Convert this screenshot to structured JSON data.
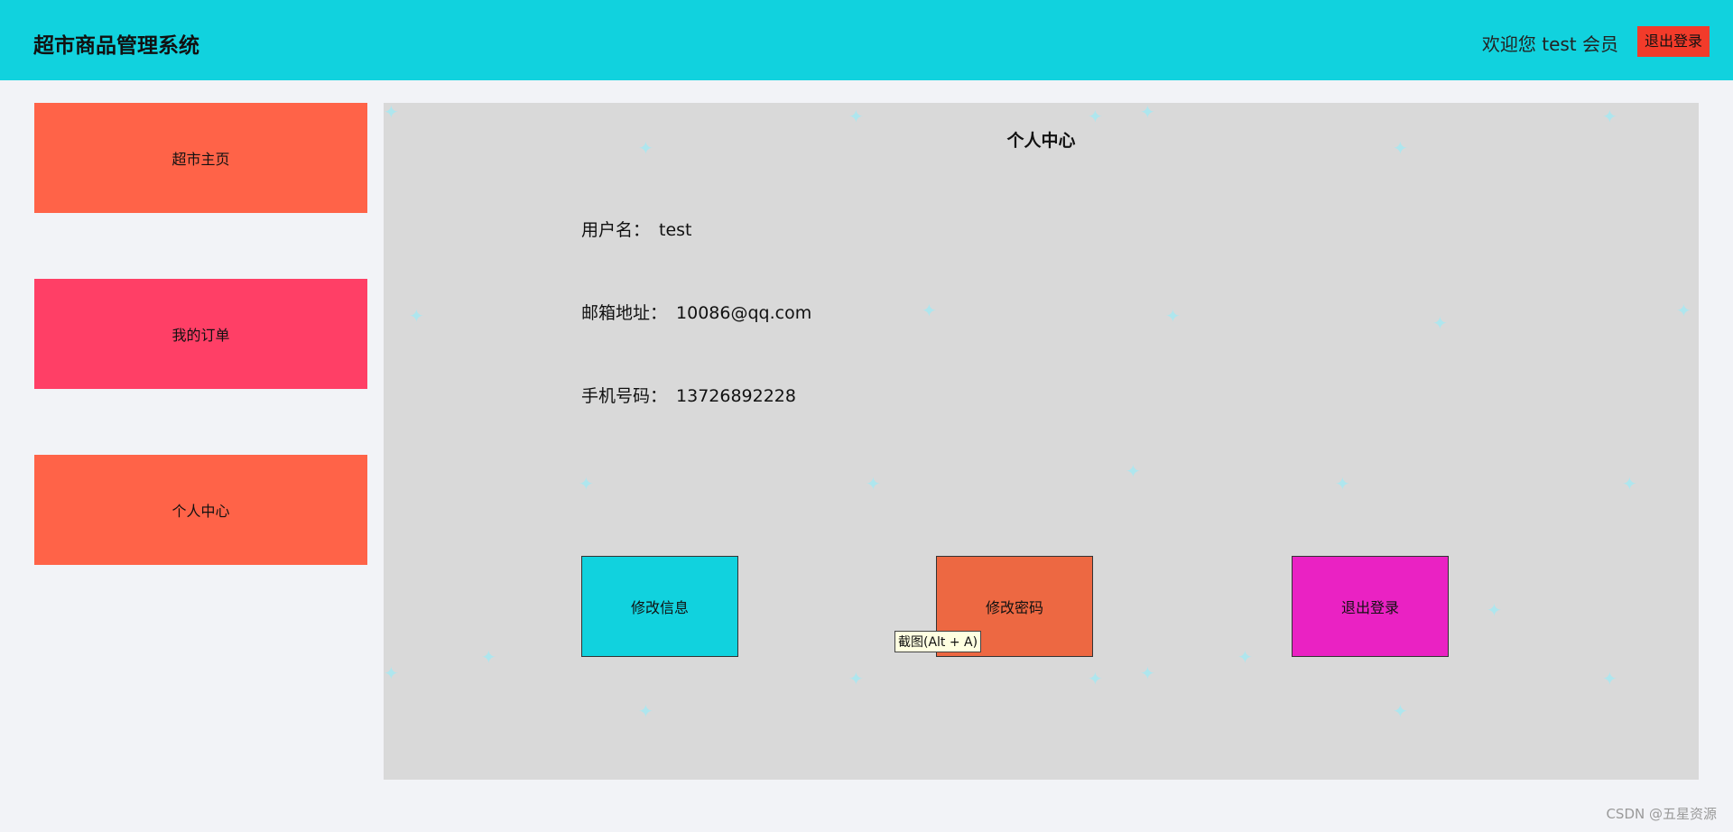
{
  "header": {
    "title": "超市商品管理系统",
    "welcome": "欢迎您 test 会员",
    "logout_label": "退出登录"
  },
  "sidebar": {
    "items": [
      {
        "label": "超市主页"
      },
      {
        "label": "我的订单"
      },
      {
        "label": "个人中心"
      }
    ]
  },
  "profile": {
    "title": "个人中心",
    "fields": [
      {
        "label": "用户名：",
        "value": "test"
      },
      {
        "label": "邮箱地址：",
        "value": "10086@qq.com"
      },
      {
        "label": "手机号码：",
        "value": "13726892228"
      }
    ],
    "buttons": {
      "edit_info": "修改信息",
      "change_password": "修改密码",
      "logout": "退出登录"
    },
    "tooltip": "截图(Alt + A)"
  },
  "watermark": "CSDN @五星资源",
  "colors": {
    "header_bg": "#11d2de",
    "nav_home": "#ff6348",
    "nav_orders": "#ff3f66",
    "nav_profile": "#ff6348",
    "panel_bg": "#d9d9d9",
    "btn_edit": "#11d2de",
    "btn_pass": "#ed6842",
    "btn_logout": "#ea22c3",
    "logout_top": "#f23b2a"
  }
}
